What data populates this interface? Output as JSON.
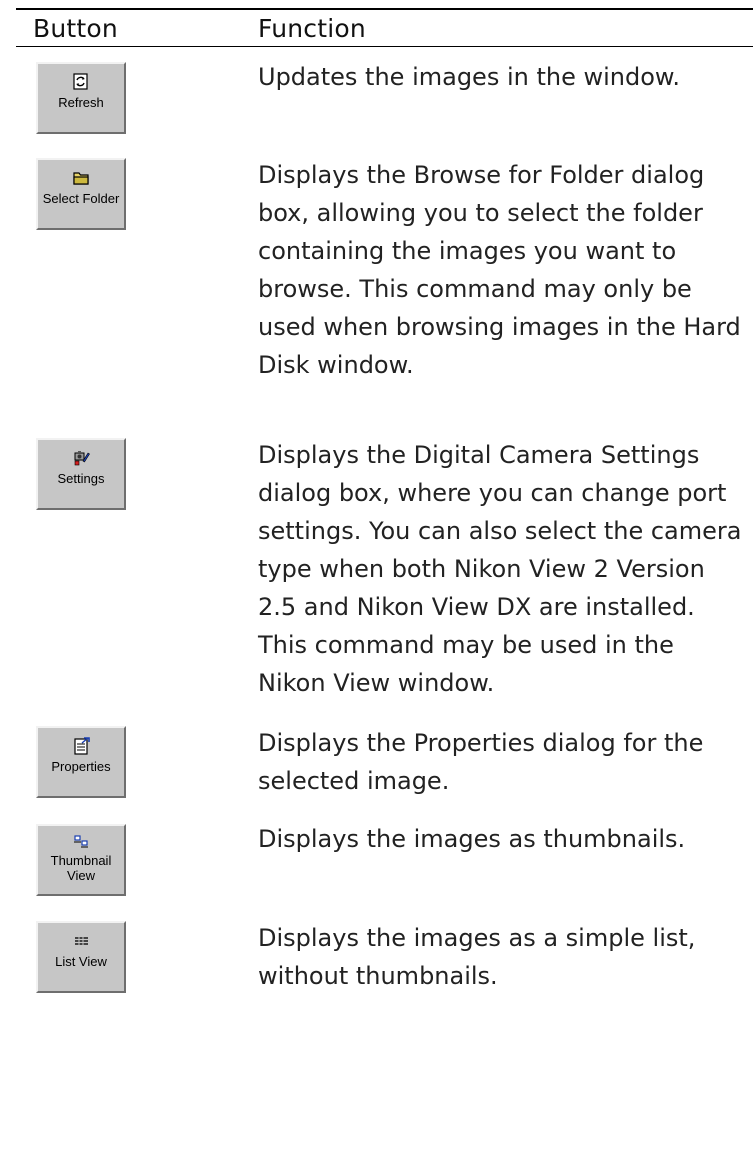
{
  "header": {
    "button_col": "Button",
    "function_col": "Function"
  },
  "rows": [
    {
      "button_label": "Refresh",
      "icon": "refresh-icon",
      "description": "Updates the images in the window."
    },
    {
      "button_label": "Select Folder",
      "icon": "folder-icon",
      "description": "Displays the Browse for Folder dialog box, allowing you to select the folder containing the images you want to browse.  This command may only be used when browsing images in the Hard Disk window."
    },
    {
      "button_label": "Settings",
      "icon": "settings-icon",
      "description": "Displays the Digital Camera Settings dialog box, where you can change port settings. You can also select the camera type when both Nikon View 2 Version 2.5 and Nikon View DX are installed. This command may be used in the Nikon View window."
    },
    {
      "button_label": "Properties",
      "icon": "properties-icon",
      "description": "Displays the Properties dialog for the selected image."
    },
    {
      "button_label": "Thumbnail\nView",
      "icon": "thumbnail-view-icon",
      "description": "Displays the images as thumbnails."
    },
    {
      "button_label": "List View",
      "icon": "list-view-icon",
      "description": "Displays the images as a simple list, without thumbnails."
    }
  ]
}
